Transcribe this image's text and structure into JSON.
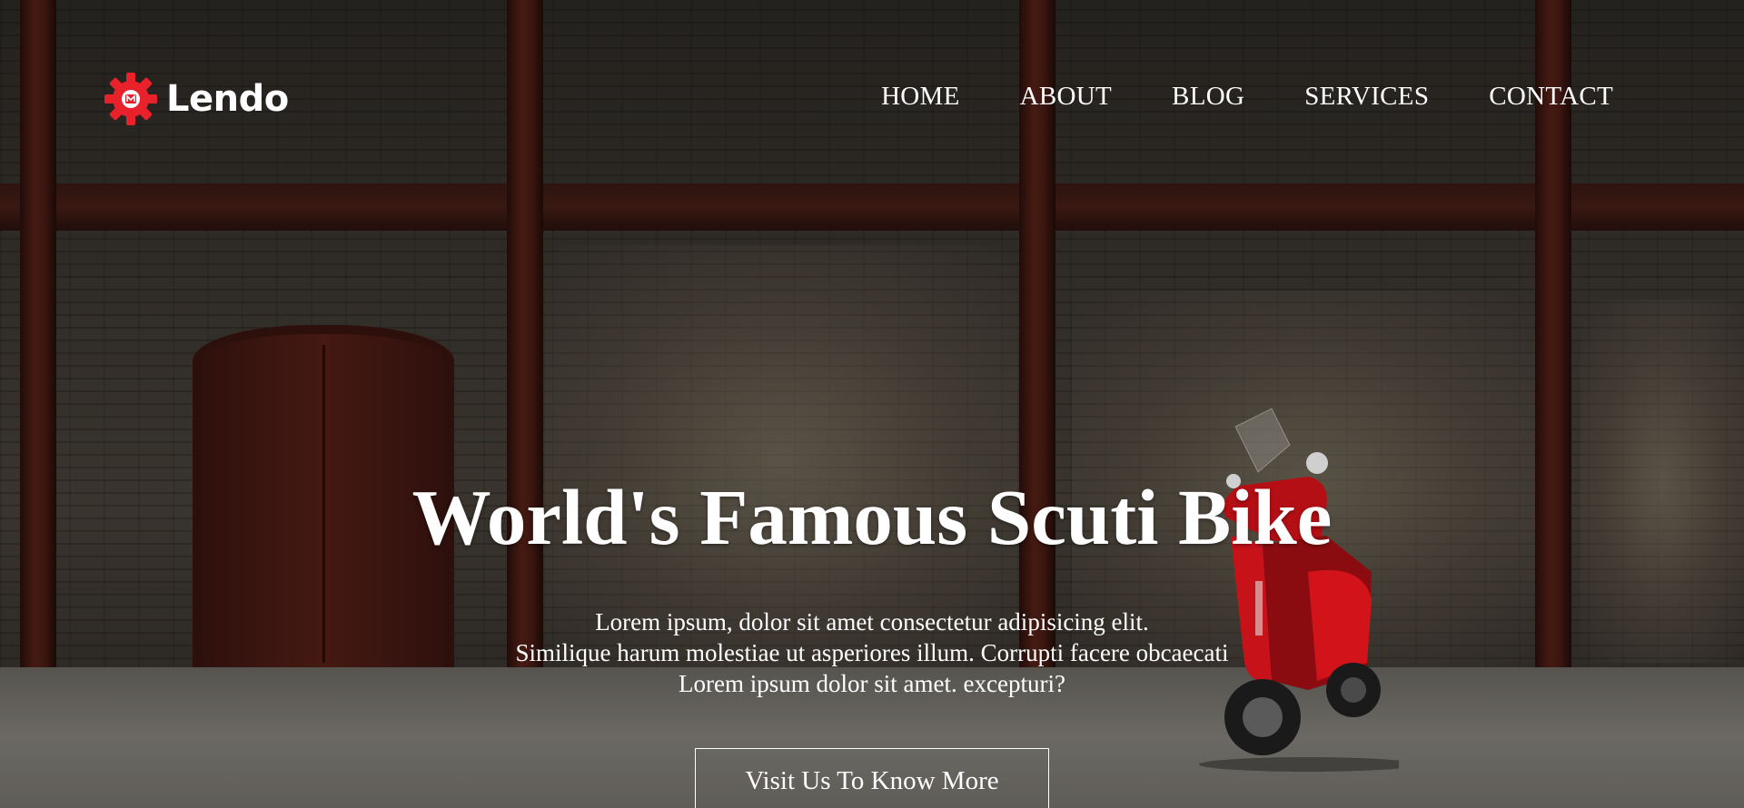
{
  "brand": {
    "name": "Lendo",
    "logo_icon": "gear-icon",
    "logo_color": "#e8212b"
  },
  "nav": {
    "items": [
      {
        "label": "HOME"
      },
      {
        "label": "ABOUT"
      },
      {
        "label": "BLOG"
      },
      {
        "label": "SERVICES"
      },
      {
        "label": "CONTACT"
      }
    ]
  },
  "hero": {
    "title": "World's Famous Scuti Bike",
    "subtitle_lines": [
      "Lorem ipsum, dolor sit amet consectetur adipisicing elit.",
      "Similique harum molestiae ut asperiores illum. Corrupti facere obcaecati",
      "Lorem ipsum dolor sit amet. excepturi?"
    ],
    "cta_label": "Visit Us To Know More"
  },
  "colors": {
    "text": "#ffffff",
    "scooter_red": "#d2141a"
  }
}
